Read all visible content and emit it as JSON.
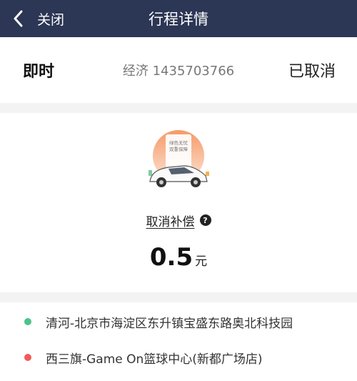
{
  "header": {
    "back_icon": "chevron-left-icon",
    "close_label": "关闭",
    "title": "行程详情"
  },
  "trip": {
    "type": "即时",
    "order_info": "经济 1435703766",
    "status": "已取消"
  },
  "compensation": {
    "illustration_text_line1": "绿色无忧",
    "illustration_text_line2": "双重保障",
    "link_label": "取消补偿",
    "help_icon": "question-circle-icon",
    "help_glyph": "?",
    "amount": "0.5",
    "unit": "元"
  },
  "route": {
    "items": [
      {
        "text": "清河-北京市海淀区东升镇宝盛东路奥北科技园",
        "color": "#4cc38a"
      },
      {
        "text": "西三旗-Game On篮球中心(新都广场店)",
        "color": "#f25a5a"
      }
    ]
  },
  "colors": {
    "header_bg": "#2c3655",
    "separator": "#f3f3f3",
    "illustration_circle": "#f7a77a"
  }
}
